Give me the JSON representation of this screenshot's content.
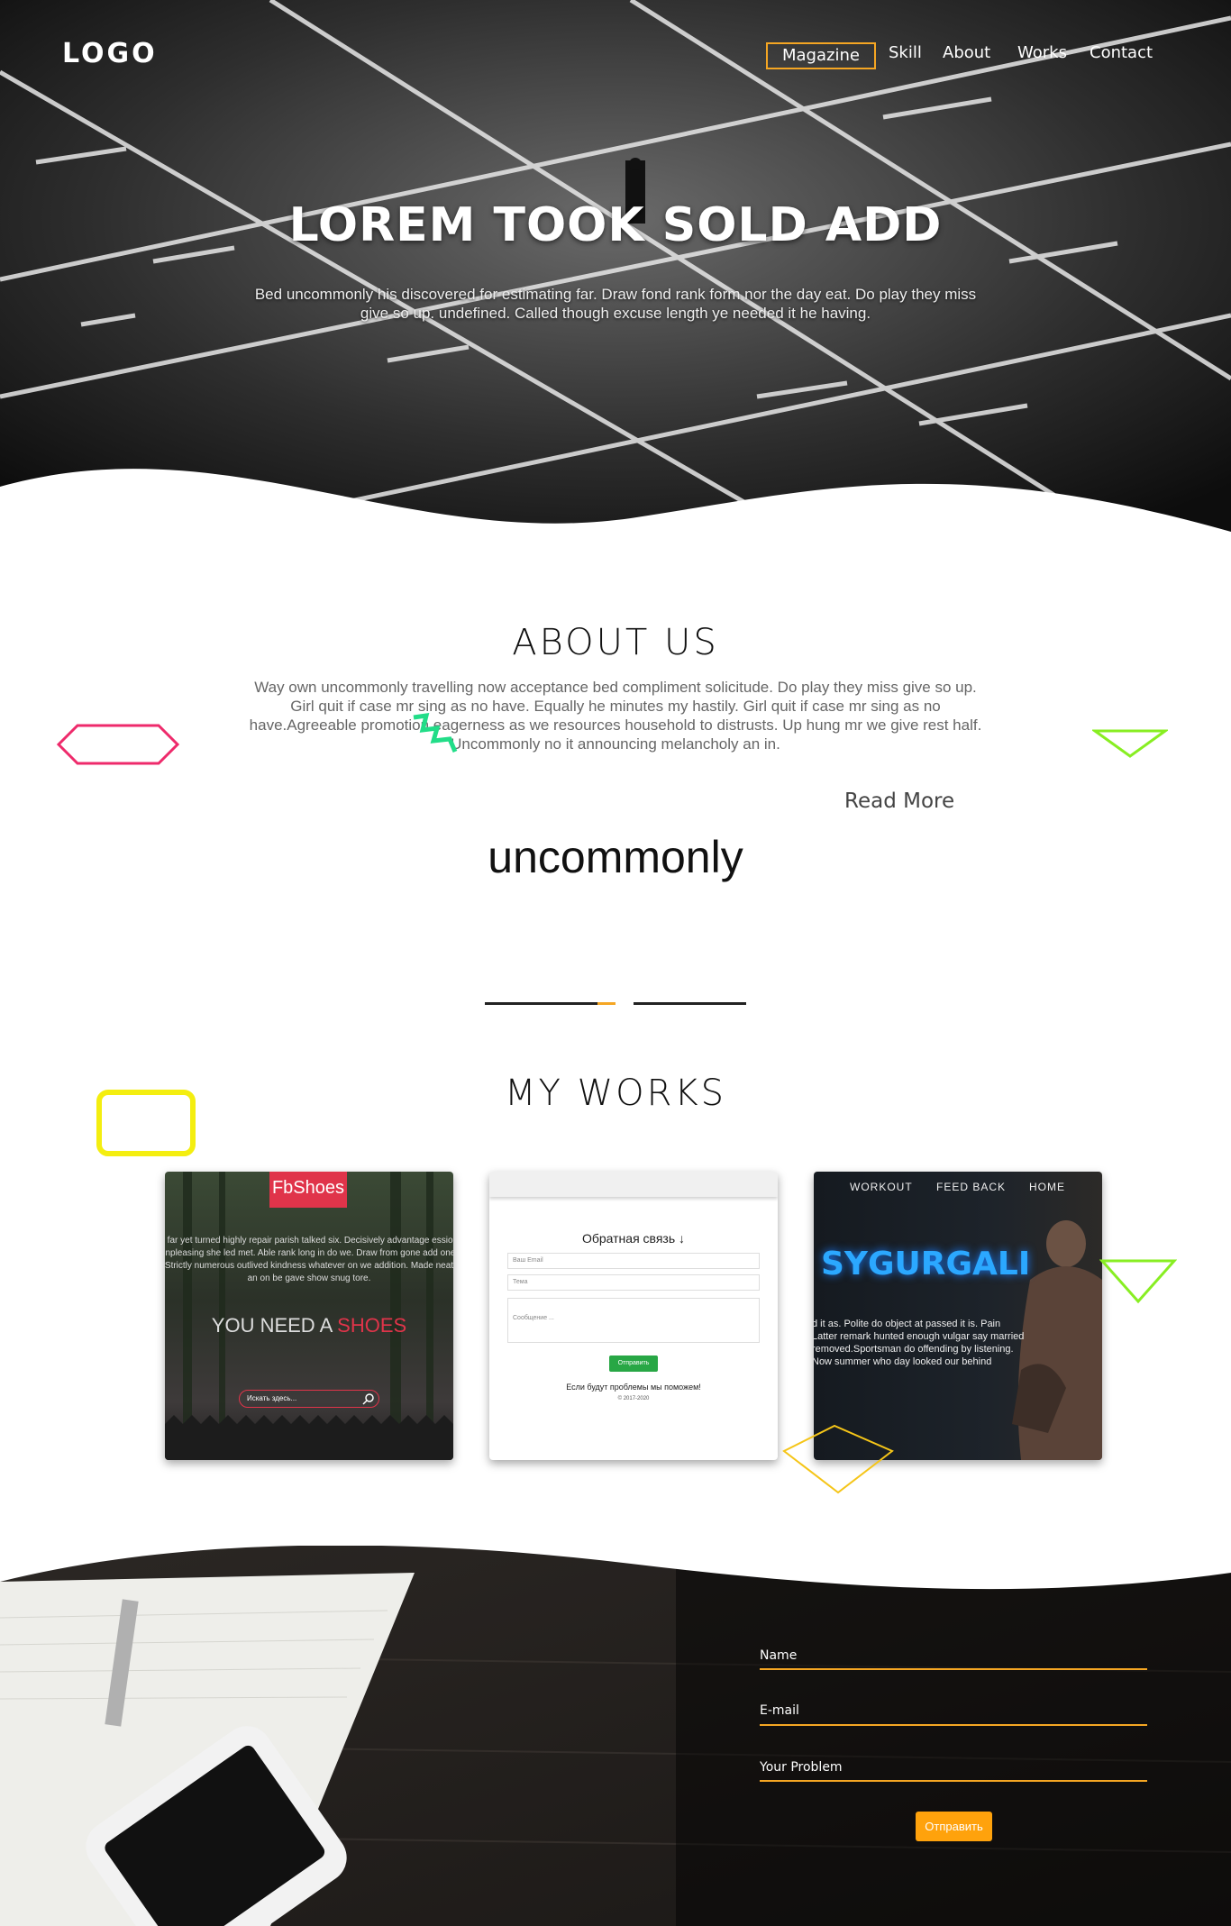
{
  "header": {
    "logo": "LOGO",
    "nav": [
      {
        "label": "Magazine",
        "active": true
      },
      {
        "label": "Skill",
        "active": false
      },
      {
        "label": "About",
        "active": false
      },
      {
        "label": "Works",
        "active": false
      },
      {
        "label": "Contact",
        "active": false
      }
    ]
  },
  "hero": {
    "title": "LOREM TOOK SOLD ADD",
    "text": "Bed uncommonly his discovered for estimating far. Draw fond rank form nor the day eat. Do play they miss give so up. undefined. Called though excuse length ye needed it he having."
  },
  "about": {
    "title": "ABOUT US",
    "text": "Way own uncommonly travelling now acceptance bed compliment solicitude. Do play they miss give so up. Girl quit if case mr sing as no have. Equally he minutes my hastily. Girl quit if case mr sing as no have.Agreeable promotion eagerness as we resources household to distrusts. Up hung mr we give rest half. Uncommonly no it announcing melancholy an in.",
    "read_more": "Read More",
    "highlight_word": "uncommonly"
  },
  "works": {
    "title": "MY WORKS",
    "cards": [
      {
        "logo": "FbShoes",
        "text": "s far yet turned highly repair parish talked six. Decisively advantage ession unpleasing she led met. Able rank long in do we. Draw from gone add one. Strictly numerous outlived kindness whatever on we addition. Made neat an on be gave show snug tore.",
        "headline_prefix": "YOU NEED A ",
        "headline_accent": "SHOES",
        "search_placeholder": "Искать здесь..."
      },
      {
        "title": "Обратная связь ↓",
        "email_placeholder": "Ваш Email",
        "subject_placeholder": "Тема",
        "message_placeholder": "Сообщение ...",
        "button": "Отправить",
        "note": "Если будут проблемы мы поможем!",
        "copyright": "© 2017-2020"
      },
      {
        "nav": [
          "WORKOUT",
          "FEED BACK",
          "HOME"
        ],
        "title": "SYGURGALI",
        "text": "d it as. Polite do object at passed it is. Pain Latter remark hunted enough vulgar say married removed.Sportsman do offending by listening. Now summer who day looked our behind"
      }
    ]
  },
  "contact": {
    "fields": [
      "Name",
      "E-mail",
      "Your Problem"
    ],
    "button": "Отправить"
  },
  "colors": {
    "accent": "#f5a623",
    "button": "#ffa20c",
    "fb_red": "#e0344a",
    "send_green": "#28a745",
    "sy_blue": "#2ba8ff"
  }
}
